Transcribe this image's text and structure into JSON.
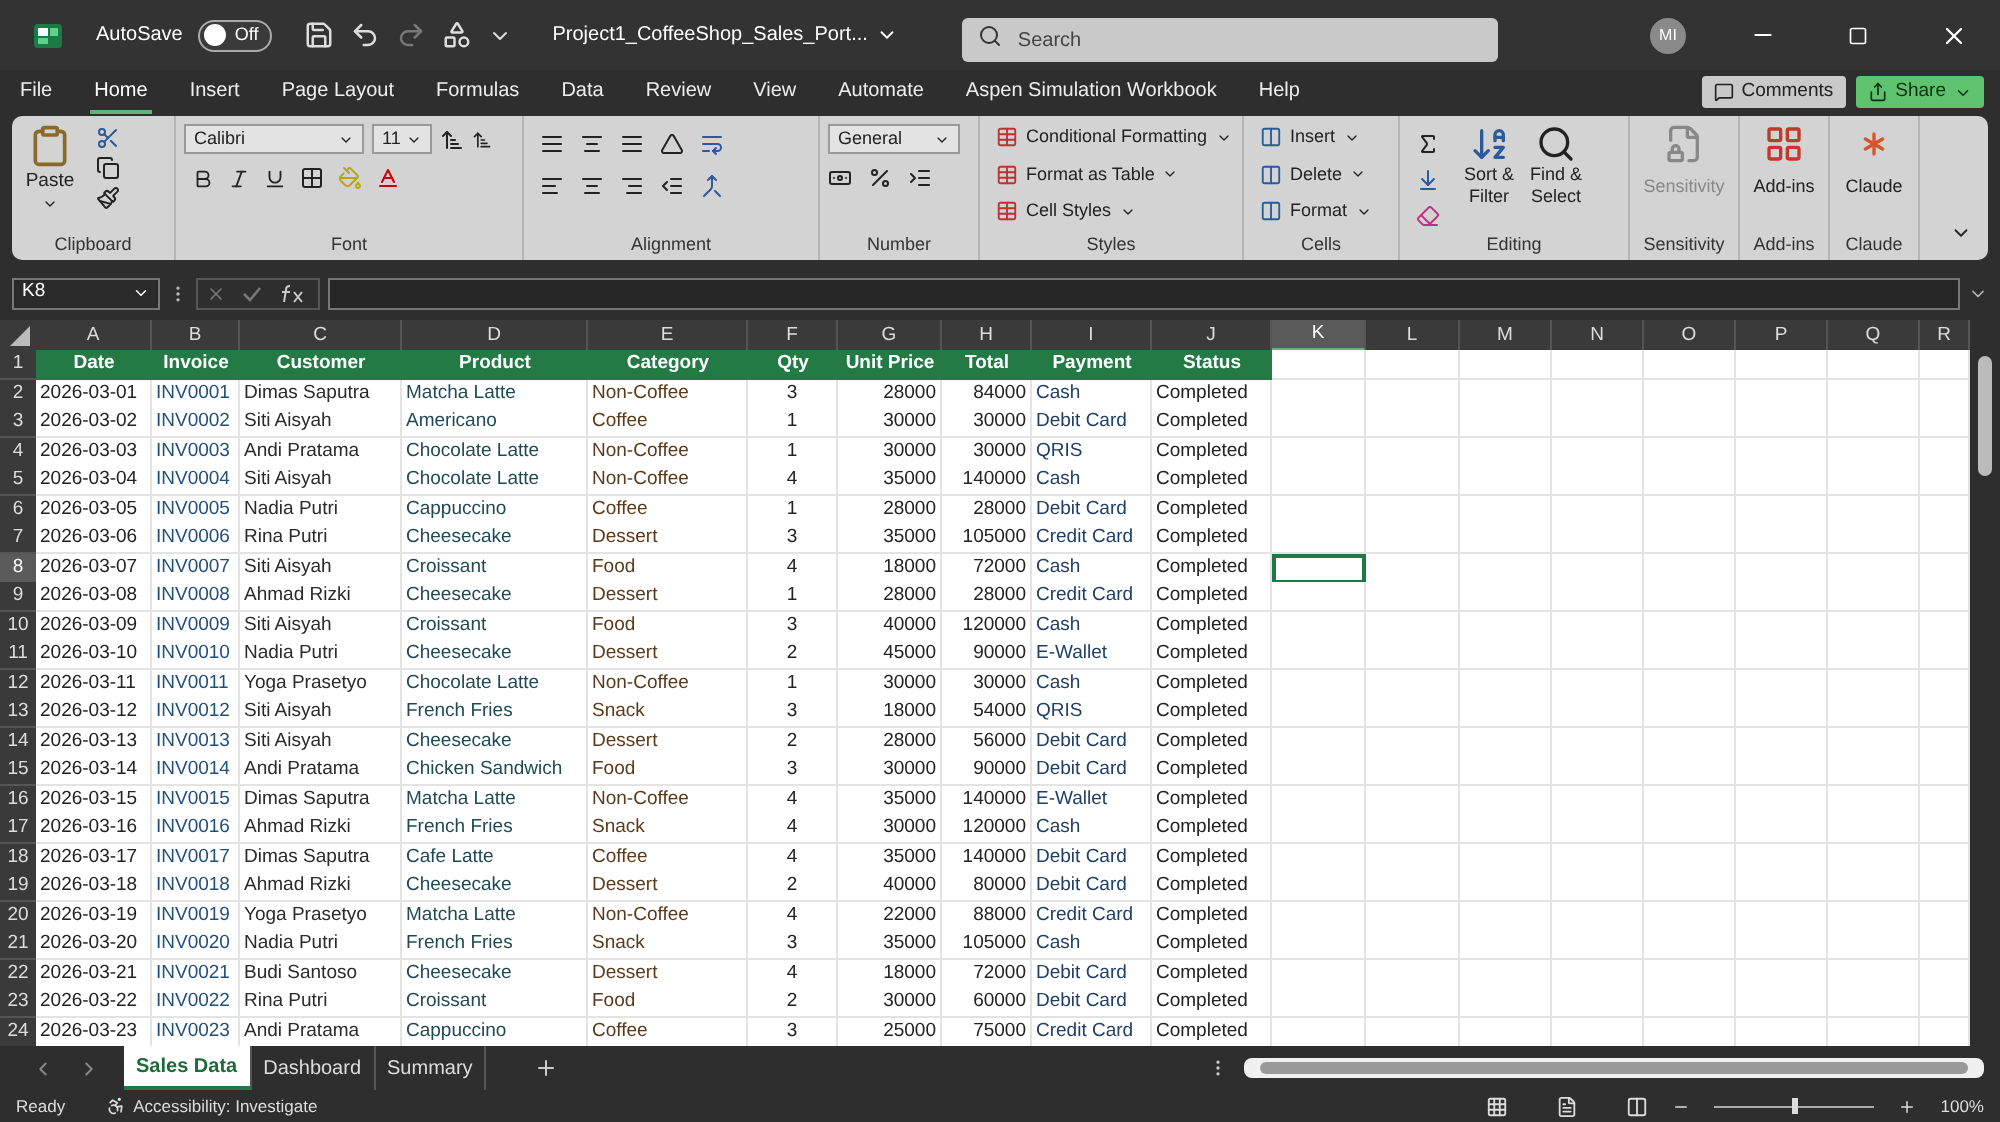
{
  "title_bar": {
    "autosave_label": "AutoSave",
    "autosave_toggle": {
      "label": "Off",
      "on": false
    },
    "file_name": "Project1_CoffeeShop_Sales_Port...",
    "search": {
      "placeholder": "Search"
    },
    "avatar": "MI"
  },
  "menu_tabs": [
    {
      "label": "File",
      "selected": false
    },
    {
      "label": "Home",
      "selected": true
    },
    {
      "label": "Insert",
      "selected": false
    },
    {
      "label": "Page Layout",
      "selected": false
    },
    {
      "label": "Formulas",
      "selected": false
    },
    {
      "label": "Data",
      "selected": false
    },
    {
      "label": "Review",
      "selected": false
    },
    {
      "label": "View",
      "selected": false
    },
    {
      "label": "Automate",
      "selected": false
    },
    {
      "label": "Aspen Simulation Workbook",
      "selected": false
    },
    {
      "label": "Help",
      "selected": false
    }
  ],
  "comments_button": "Comments",
  "share_button": "Share",
  "ribbon": {
    "clipboard": {
      "paste": "Paste",
      "label": "Clipboard"
    },
    "font": {
      "font_name": "Calibri",
      "font_size": "11",
      "label": "Font"
    },
    "alignment": {
      "label": "Alignment"
    },
    "number": {
      "format": "General",
      "label": "Number"
    },
    "styles": {
      "items": [
        "Conditional Formatting",
        "Format as Table",
        "Cell Styles"
      ],
      "label": "Styles"
    },
    "cells": {
      "items": [
        "Insert",
        "Delete",
        "Format"
      ],
      "label": "Cells"
    },
    "editing": {
      "sort_lines": [
        "Sort &",
        "Filter"
      ],
      "find_lines": [
        "Find &",
        "Select"
      ],
      "label": "Editing"
    },
    "sensitivity": {
      "button": "Sensitivity",
      "disabled": true,
      "label": "Sensitivity"
    },
    "addins": {
      "button": "Add-ins",
      "label": "Add-ins"
    },
    "claude": {
      "button": "Claude",
      "label": "Claude"
    }
  },
  "name_box": "K8",
  "columns": [
    {
      "label": "A",
      "selected": false
    },
    {
      "label": "B",
      "selected": false
    },
    {
      "label": "C",
      "selected": false
    },
    {
      "label": "D",
      "selected": false
    },
    {
      "label": "E",
      "selected": false
    },
    {
      "label": "F",
      "selected": false
    },
    {
      "label": "G",
      "selected": false
    },
    {
      "label": "H",
      "selected": false
    },
    {
      "label": "I",
      "selected": false
    },
    {
      "label": "J",
      "selected": false
    },
    {
      "label": "K",
      "selected": true
    },
    {
      "label": "L",
      "selected": false
    },
    {
      "label": "M",
      "selected": false
    },
    {
      "label": "N",
      "selected": false
    },
    {
      "label": "O",
      "selected": false
    },
    {
      "label": "P",
      "selected": false
    },
    {
      "label": "Q",
      "selected": false
    },
    {
      "label": "R",
      "selected": false
    }
  ],
  "header_row": {
    "number": "1",
    "selected": false,
    "cells": [
      "Date",
      "Invoice",
      "Customer",
      "Product",
      "Category",
      "Qty",
      "Unit Price",
      "Total",
      "Payment",
      "Status"
    ]
  },
  "rows": [
    {
      "number": "2",
      "selected": false,
      "cells": [
        "2026-03-01",
        "INV0001",
        "Dimas Saputra",
        "Matcha Latte",
        "Non-Coffee",
        "3",
        "28000",
        "84000",
        "Cash",
        "Completed"
      ]
    },
    {
      "number": "3",
      "selected": false,
      "cells": [
        "2026-03-02",
        "INV0002",
        "Siti Aisyah",
        "Americano",
        "Coffee",
        "1",
        "30000",
        "30000",
        "Debit Card",
        "Completed"
      ]
    },
    {
      "number": "4",
      "selected": false,
      "cells": [
        "2026-03-03",
        "INV0003",
        "Andi Pratama",
        "Chocolate Latte",
        "Non-Coffee",
        "1",
        "30000",
        "30000",
        "QRIS",
        "Completed"
      ]
    },
    {
      "number": "5",
      "selected": false,
      "cells": [
        "2026-03-04",
        "INV0004",
        "Siti Aisyah",
        "Chocolate Latte",
        "Non-Coffee",
        "4",
        "35000",
        "140000",
        "Cash",
        "Completed"
      ]
    },
    {
      "number": "6",
      "selected": false,
      "cells": [
        "2026-03-05",
        "INV0005",
        "Nadia Putri",
        "Cappuccino",
        "Coffee",
        "1",
        "28000",
        "28000",
        "Debit Card",
        "Completed"
      ]
    },
    {
      "number": "7",
      "selected": false,
      "cells": [
        "2026-03-06",
        "INV0006",
        "Rina Putri",
        "Cheesecake",
        "Dessert",
        "3",
        "35000",
        "105000",
        "Credit Card",
        "Completed"
      ]
    },
    {
      "number": "8",
      "selected": true,
      "cells": [
        "2026-03-07",
        "INV0007",
        "Siti Aisyah",
        "Croissant",
        "Food",
        "4",
        "18000",
        "72000",
        "Cash",
        "Completed"
      ]
    },
    {
      "number": "9",
      "selected": false,
      "cells": [
        "2026-03-08",
        "INV0008",
        "Ahmad Rizki",
        "Cheesecake",
        "Dessert",
        "1",
        "28000",
        "28000",
        "Credit Card",
        "Completed"
      ]
    },
    {
      "number": "10",
      "selected": false,
      "cells": [
        "2026-03-09",
        "INV0009",
        "Siti Aisyah",
        "Croissant",
        "Food",
        "3",
        "40000",
        "120000",
        "Cash",
        "Completed"
      ]
    },
    {
      "number": "11",
      "selected": false,
      "cells": [
        "2026-03-10",
        "INV0010",
        "Nadia Putri",
        "Cheesecake",
        "Dessert",
        "2",
        "45000",
        "90000",
        "E-Wallet",
        "Completed"
      ]
    },
    {
      "number": "12",
      "selected": false,
      "cells": [
        "2026-03-11",
        "INV0011",
        "Yoga Prasetyo",
        "Chocolate Latte",
        "Non-Coffee",
        "1",
        "30000",
        "30000",
        "Cash",
        "Completed"
      ]
    },
    {
      "number": "13",
      "selected": false,
      "cells": [
        "2026-03-12",
        "INV0012",
        "Siti Aisyah",
        "French Fries",
        "Snack",
        "3",
        "18000",
        "54000",
        "QRIS",
        "Completed"
      ]
    },
    {
      "number": "14",
      "selected": false,
      "cells": [
        "2026-03-13",
        "INV0013",
        "Siti Aisyah",
        "Cheesecake",
        "Dessert",
        "2",
        "28000",
        "56000",
        "Debit Card",
        "Completed"
      ]
    },
    {
      "number": "15",
      "selected": false,
      "cells": [
        "2026-03-14",
        "INV0014",
        "Andi Pratama",
        "Chicken Sandwich",
        "Food",
        "3",
        "30000",
        "90000",
        "Debit Card",
        "Completed"
      ]
    },
    {
      "number": "16",
      "selected": false,
      "cells": [
        "2026-03-15",
        "INV0015",
        "Dimas Saputra",
        "Matcha Latte",
        "Non-Coffee",
        "4",
        "35000",
        "140000",
        "E-Wallet",
        "Completed"
      ]
    },
    {
      "number": "17",
      "selected": false,
      "cells": [
        "2026-03-16",
        "INV0016",
        "Ahmad Rizki",
        "French Fries",
        "Snack",
        "4",
        "30000",
        "120000",
        "Cash",
        "Completed"
      ]
    },
    {
      "number": "18",
      "selected": false,
      "cells": [
        "2026-03-17",
        "INV0017",
        "Dimas Saputra",
        "Cafe Latte",
        "Coffee",
        "4",
        "35000",
        "140000",
        "Debit Card",
        "Completed"
      ]
    },
    {
      "number": "19",
      "selected": false,
      "cells": [
        "2026-03-18",
        "INV0018",
        "Ahmad Rizki",
        "Cheesecake",
        "Dessert",
        "2",
        "40000",
        "80000",
        "Debit Card",
        "Completed"
      ]
    },
    {
      "number": "20",
      "selected": false,
      "cells": [
        "2026-03-19",
        "INV0019",
        "Yoga Prasetyo",
        "Matcha Latte",
        "Non-Coffee",
        "4",
        "22000",
        "88000",
        "Credit Card",
        "Completed"
      ]
    },
    {
      "number": "21",
      "selected": false,
      "cells": [
        "2026-03-20",
        "INV0020",
        "Nadia Putri",
        "French Fries",
        "Snack",
        "3",
        "35000",
        "105000",
        "Cash",
        "Completed"
      ]
    },
    {
      "number": "22",
      "selected": false,
      "cells": [
        "2026-03-21",
        "INV0021",
        "Budi Santoso",
        "Cheesecake",
        "Dessert",
        "4",
        "18000",
        "72000",
        "Debit Card",
        "Completed"
      ]
    },
    {
      "number": "23",
      "selected": false,
      "cells": [
        "2026-03-22",
        "INV0022",
        "Rina Putri",
        "Croissant",
        "Food",
        "2",
        "30000",
        "60000",
        "Debit Card",
        "Completed"
      ]
    },
    {
      "number": "24",
      "selected": false,
      "cells": [
        "2026-03-23",
        "INV0023",
        "Andi Pratama",
        "Cappuccino",
        "Coffee",
        "3",
        "25000",
        "75000",
        "Credit Card",
        "Completed"
      ]
    }
  ],
  "sheet_tabs": [
    {
      "label": "Sales Data",
      "selected": true
    },
    {
      "label": "Dashboard",
      "selected": false
    },
    {
      "label": "Summary",
      "selected": false
    }
  ],
  "status_bar": {
    "ready": "Ready",
    "accessibility": "Accessibility: Investigate",
    "zoom_slider": {
      "level": 0.5
    },
    "zoom": "100%"
  }
}
